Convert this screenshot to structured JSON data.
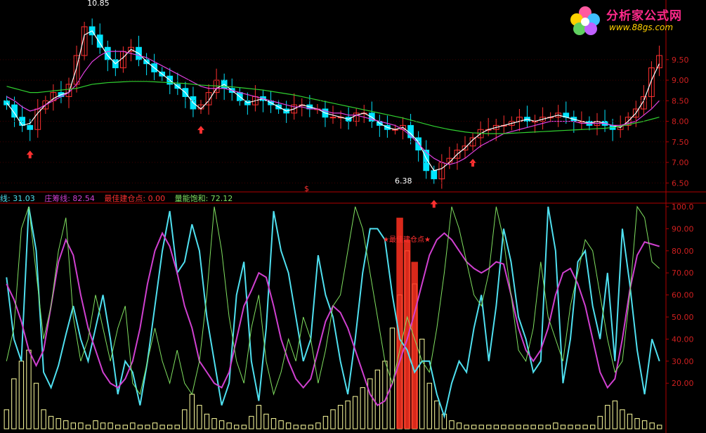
{
  "logo": {
    "brand_text": "分析家公式网",
    "url_text": "www.88gs.com"
  },
  "colors": {
    "background": "#000000",
    "frame": "#b00000",
    "up_candle": "#ff3030",
    "down_candle": "#00e5ff",
    "ma_white": "#ffffff",
    "ma_magenta": "#e040e0",
    "ma_green": "#30d030",
    "cyan_line": "#4fe0f0",
    "magenta_line": "#d040d0",
    "green_line": "#80e060",
    "yellow_bar": "#ffffa0",
    "red_bar": "#ff3020",
    "axis_text": "#d02020"
  },
  "legend": {
    "cyan_label": "线: 31.03",
    "magenta_label": "庄筹线: 82.54",
    "red_label": "最佳建仓点: 0.00",
    "green_label": "量能饱和: 72.12"
  },
  "chart_data": [
    {
      "type": "candlestick",
      "title": "",
      "y_ticks": [
        "9.50",
        "9.00",
        "8.50",
        "8.00",
        "7.50",
        "7.00",
        "6.50"
      ],
      "ylim": [
        6.3,
        10.95
      ],
      "annotations": {
        "high_label": "10.85",
        "low_label": "6.38",
        "marker_symbol": "$"
      },
      "buy_arrow_positions_index": [
        3,
        25,
        55,
        60
      ],
      "ma_series": [
        {
          "color_key": "ma_white",
          "values": [
            8.45,
            8.2,
            7.9,
            7.95,
            8.2,
            8.4,
            8.55,
            8.65,
            8.7,
            9.3,
            10.1,
            10.2,
            9.9,
            9.6,
            9.4,
            9.55,
            9.75,
            9.65,
            9.45,
            9.3,
            9.15,
            9.0,
            8.85,
            8.7,
            8.45,
            8.3,
            8.5,
            8.8,
            8.9,
            8.75,
            8.6,
            8.45,
            8.5,
            8.55,
            8.45,
            8.35,
            8.25,
            8.3,
            8.4,
            8.35,
            8.3,
            8.2,
            8.15,
            8.1,
            8.05,
            8.15,
            8.2,
            8.1,
            7.95,
            7.85,
            7.8,
            7.85,
            7.7,
            7.5,
            7.1,
            6.8,
            6.85,
            7.0,
            7.2,
            7.35,
            7.55,
            7.7,
            7.8,
            7.85,
            7.9,
            7.95,
            8.0,
            8.05,
            8.0,
            8.05,
            8.1,
            8.15,
            8.1,
            8.05,
            8.0,
            7.95,
            8.0,
            7.95,
            7.9,
            7.85,
            8.0,
            8.2,
            8.5,
            9.0,
            9.4
          ]
        },
        {
          "color_key": "ma_magenta",
          "values": [
            8.6,
            8.5,
            8.35,
            8.25,
            8.3,
            8.4,
            8.5,
            8.6,
            8.7,
            8.9,
            9.2,
            9.45,
            9.6,
            9.7,
            9.7,
            9.7,
            9.65,
            9.6,
            9.55,
            9.45,
            9.35,
            9.25,
            9.15,
            9.05,
            8.95,
            8.85,
            8.8,
            8.8,
            8.8,
            8.75,
            8.7,
            8.65,
            8.6,
            8.55,
            8.5,
            8.45,
            8.4,
            8.35,
            8.35,
            8.3,
            8.3,
            8.25,
            8.2,
            8.2,
            8.15,
            8.15,
            8.1,
            8.05,
            8.0,
            7.95,
            7.9,
            7.8,
            7.65,
            7.45,
            7.25,
            7.1,
            7.0,
            6.95,
            7.0,
            7.1,
            7.25,
            7.4,
            7.5,
            7.6,
            7.7,
            7.75,
            7.8,
            7.85,
            7.9,
            7.95,
            8.0,
            8.0,
            8.0,
            8.0,
            7.95,
            7.95,
            7.95,
            7.95,
            7.9,
            7.9,
            7.95,
            8.0,
            8.15,
            8.3,
            8.5
          ]
        },
        {
          "color_key": "ma_green",
          "values": [
            8.85,
            8.8,
            8.75,
            8.7,
            8.7,
            8.72,
            8.74,
            8.76,
            8.78,
            8.8,
            8.85,
            8.9,
            8.92,
            8.94,
            8.95,
            8.96,
            8.97,
            8.97,
            8.97,
            8.96,
            8.95,
            8.94,
            8.93,
            8.92,
            8.9,
            8.88,
            8.87,
            8.86,
            8.85,
            8.84,
            8.82,
            8.8,
            8.78,
            8.76,
            8.73,
            8.7,
            8.67,
            8.64,
            8.6,
            8.56,
            8.52,
            8.48,
            8.44,
            8.4,
            8.36,
            8.32,
            8.28,
            8.24,
            8.2,
            8.16,
            8.12,
            8.08,
            8.03,
            7.98,
            7.93,
            7.88,
            7.84,
            7.8,
            7.77,
            7.74,
            7.72,
            7.71,
            7.7,
            7.7,
            7.7,
            7.71,
            7.72,
            7.73,
            7.74,
            7.75,
            7.76,
            7.77,
            7.78,
            7.79,
            7.8,
            7.81,
            7.82,
            7.83,
            7.85,
            7.88,
            7.92,
            7.96,
            8.0,
            8.05,
            8.1
          ]
        }
      ],
      "closes": [
        8.4,
        8.1,
        7.9,
        7.8,
        8.3,
        8.5,
        8.7,
        8.6,
        8.9,
        9.6,
        10.3,
        10.1,
        9.8,
        9.5,
        9.3,
        9.7,
        9.8,
        9.5,
        9.4,
        9.2,
        9.1,
        8.9,
        8.8,
        8.6,
        8.3,
        8.4,
        8.7,
        9.0,
        8.8,
        8.7,
        8.5,
        8.4,
        8.6,
        8.5,
        8.4,
        8.3,
        8.2,
        8.4,
        8.4,
        8.3,
        8.3,
        8.1,
        8.1,
        8.1,
        8.0,
        8.2,
        8.2,
        8.0,
        7.9,
        7.8,
        7.8,
        7.9,
        7.6,
        7.3,
        6.8,
        6.6,
        7.0,
        7.1,
        7.3,
        7.4,
        7.6,
        7.8,
        7.8,
        7.9,
        7.9,
        8.0,
        8.1,
        8.0,
        8.0,
        8.1,
        8.1,
        8.2,
        8.1,
        8.0,
        8.0,
        7.9,
        8.0,
        7.9,
        7.8,
        7.9,
        8.1,
        8.3,
        8.6,
        9.3,
        9.6
      ]
    },
    {
      "type": "line",
      "title": "",
      "y_ticks": [
        "100.0",
        "90.00",
        "80.00",
        "70.00",
        "60.00",
        "50.00",
        "40.00",
        "30.00",
        "20.00"
      ],
      "ylim": [
        0,
        100
      ],
      "annotations": {
        "signal_text": "★最佳建仓点★"
      },
      "series": [
        {
          "name": "线",
          "color_key": "cyan_line",
          "values": [
            68,
            40,
            30,
            100,
            80,
            25,
            18,
            28,
            42,
            55,
            40,
            30,
            45,
            60,
            40,
            15,
            30,
            25,
            10,
            30,
            55,
            80,
            98,
            70,
            75,
            92,
            80,
            50,
            30,
            10,
            20,
            60,
            75,
            30,
            12,
            45,
            98,
            80,
            70,
            50,
            30,
            40,
            78,
            60,
            50,
            30,
            15,
            40,
            70,
            90,
            90,
            85,
            60,
            40,
            35,
            25,
            30,
            30,
            15,
            5,
            20,
            30,
            25,
            45,
            60,
            30,
            55,
            90,
            75,
            50,
            40,
            25,
            30,
            100,
            80,
            20,
            40,
            75,
            80,
            55,
            40,
            70,
            30,
            90,
            65,
            35,
            15,
            40,
            30
          ]
        },
        {
          "name": "庄筹线",
          "color_key": "magenta_line",
          "values": [
            65,
            58,
            48,
            35,
            28,
            35,
            55,
            75,
            85,
            78,
            60,
            45,
            35,
            25,
            20,
            18,
            22,
            30,
            45,
            65,
            80,
            88,
            82,
            70,
            55,
            45,
            30,
            25,
            20,
            18,
            25,
            40,
            55,
            62,
            70,
            68,
            55,
            40,
            30,
            22,
            18,
            22,
            35,
            48,
            55,
            52,
            45,
            35,
            25,
            15,
            10,
            12,
            20,
            30,
            40,
            52,
            65,
            78,
            85,
            88,
            85,
            80,
            75,
            72,
            70,
            72,
            75,
            74,
            60,
            45,
            35,
            30,
            35,
            45,
            60,
            70,
            72,
            65,
            55,
            40,
            25,
            18,
            22,
            40,
            62,
            78,
            84,
            83,
            82
          ]
        },
        {
          "name": "量能饱和",
          "color_key": "green_line",
          "values": [
            30,
            45,
            90,
            100,
            70,
            40,
            55,
            80,
            95,
            50,
            30,
            40,
            60,
            45,
            30,
            45,
            55,
            20,
            15,
            30,
            45,
            30,
            20,
            35,
            20,
            15,
            30,
            60,
            100,
            80,
            50,
            30,
            20,
            45,
            60,
            30,
            15,
            25,
            40,
            30,
            50,
            40,
            20,
            35,
            55,
            60,
            80,
            100,
            90,
            70,
            50,
            30,
            20,
            35,
            50,
            40,
            30,
            25,
            45,
            70,
            100,
            90,
            75,
            60,
            55,
            70,
            100,
            85,
            60,
            35,
            30,
            45,
            75,
            50,
            40,
            30,
            55,
            70,
            85,
            80,
            60,
            40,
            25,
            30,
            60,
            100,
            95,
            75,
            72
          ]
        },
        {
          "name": "volume_bars",
          "color_key": "yellow_bar",
          "values": [
            8,
            22,
            30,
            35,
            20,
            8,
            5,
            4,
            3,
            2,
            2,
            1,
            3,
            2,
            2,
            1,
            1,
            2,
            1,
            1,
            2,
            1,
            1,
            1,
            8,
            15,
            10,
            6,
            4,
            3,
            2,
            1,
            1,
            5,
            10,
            6,
            4,
            3,
            2,
            1,
            1,
            1,
            2,
            5,
            8,
            10,
            12,
            14,
            18,
            22,
            26,
            30,
            45,
            60,
            80,
            65,
            40,
            20,
            12,
            6,
            3,
            2,
            1,
            1,
            1,
            1,
            1,
            1,
            1,
            1,
            1,
            1,
            1,
            1,
            2,
            1,
            1,
            1,
            1,
            1,
            5,
            10,
            12,
            8,
            6,
            4,
            3,
            2,
            1
          ]
        }
      ],
      "red_signal_bars_index": [
        53,
        54,
        55
      ]
    }
  ]
}
